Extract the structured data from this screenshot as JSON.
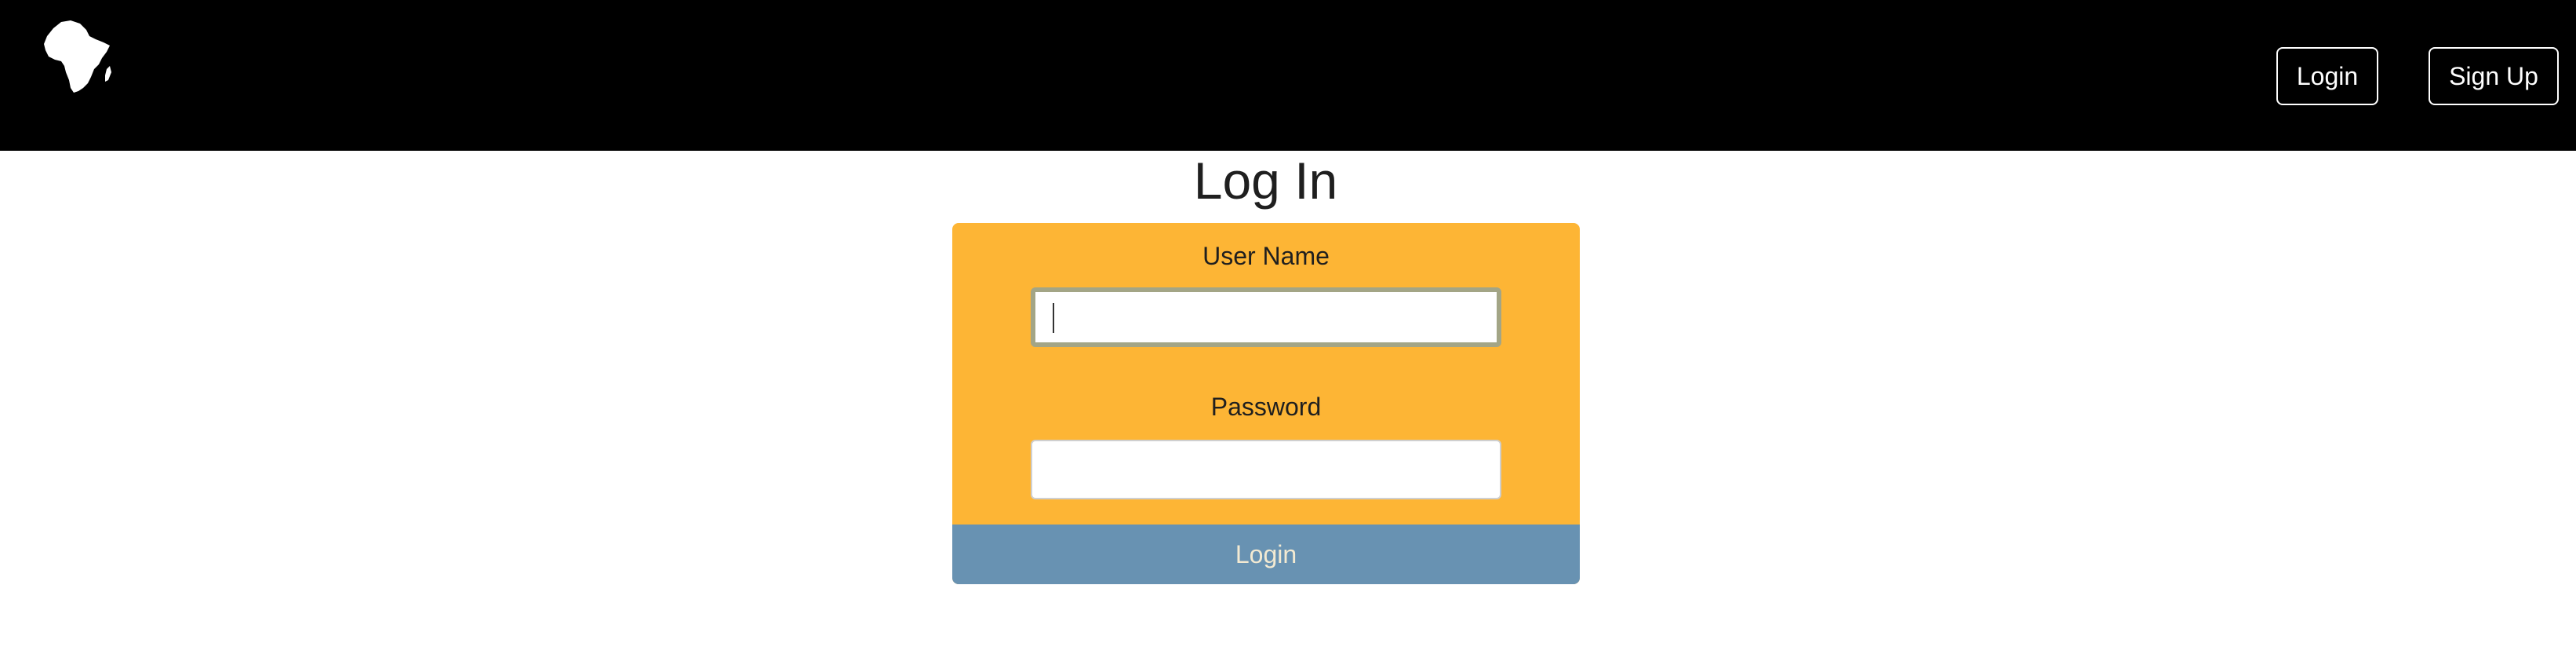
{
  "header": {
    "logo_icon": "africa-map-icon",
    "login_label": "Login",
    "signup_label": "Sign Up"
  },
  "main": {
    "title": "Log In"
  },
  "form": {
    "username_label": "User Name",
    "username_value": "",
    "password_label": "Password",
    "password_value": "",
    "submit_label": "Login"
  },
  "colors": {
    "navbar": "#000000",
    "card": "#fdb535",
    "submit_button": "#6892b2",
    "submit_text": "#f3ead2"
  }
}
